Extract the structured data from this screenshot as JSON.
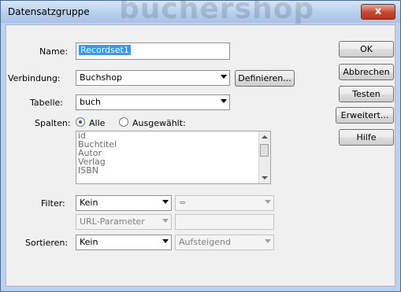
{
  "window": {
    "title": "Datensatzgruppe",
    "watermark": "buchershop",
    "close_glyph": "x"
  },
  "form": {
    "name_label": "Name:",
    "name_value": "Recordset1",
    "verbindung_label": "Verbindung:",
    "verbindung_value": "Buchshop",
    "definieren_label": "Definieren...",
    "tabelle_label": "Tabelle:",
    "tabelle_value": "buch",
    "spalten_label": "Spalten:",
    "radio_alle": "Alle",
    "radio_ausgewaehlt": "Ausgewählt:",
    "columns": [
      "id",
      "Buchtitel",
      "Autor",
      "Verlag",
      "ISBN"
    ],
    "filter_label": "Filter:",
    "filter_value": "Kein",
    "filter_operator": "=",
    "filter_source": "URL-Parameter",
    "sortieren_label": "Sortieren:",
    "sortieren_value": "Kein",
    "sort_order": "Aufsteigend"
  },
  "buttons": {
    "ok": "OK",
    "abbrechen": "Abbrechen",
    "testen": "Testen",
    "erweitert": "Erweitert...",
    "hilfe": "Hilfe"
  },
  "colors": {
    "selection": "#3399ff",
    "frame": "#bcd2ec",
    "close": "#c9452e"
  }
}
